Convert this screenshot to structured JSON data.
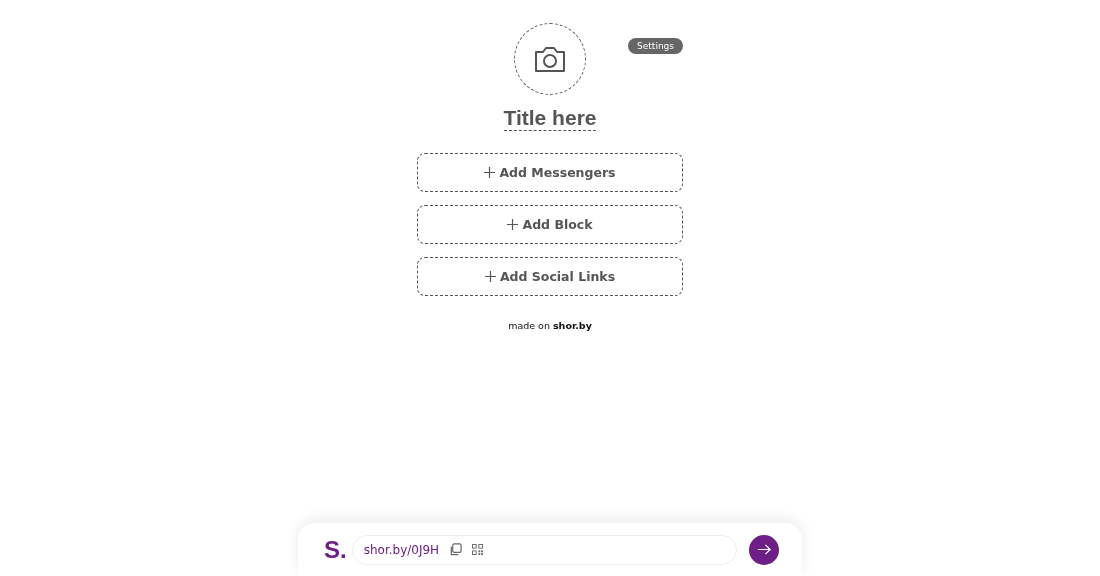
{
  "settings_button": "Settings",
  "title": "Title here",
  "add_buttons": [
    {
      "label": "Add Messengers"
    },
    {
      "label": "Add Block"
    },
    {
      "label": "Add Social Links"
    }
  ],
  "footer": "made on **shor.by**",
  "bottom_bar": {
    "logo": "S.",
    "short_link": "shor.by/0J9H"
  }
}
